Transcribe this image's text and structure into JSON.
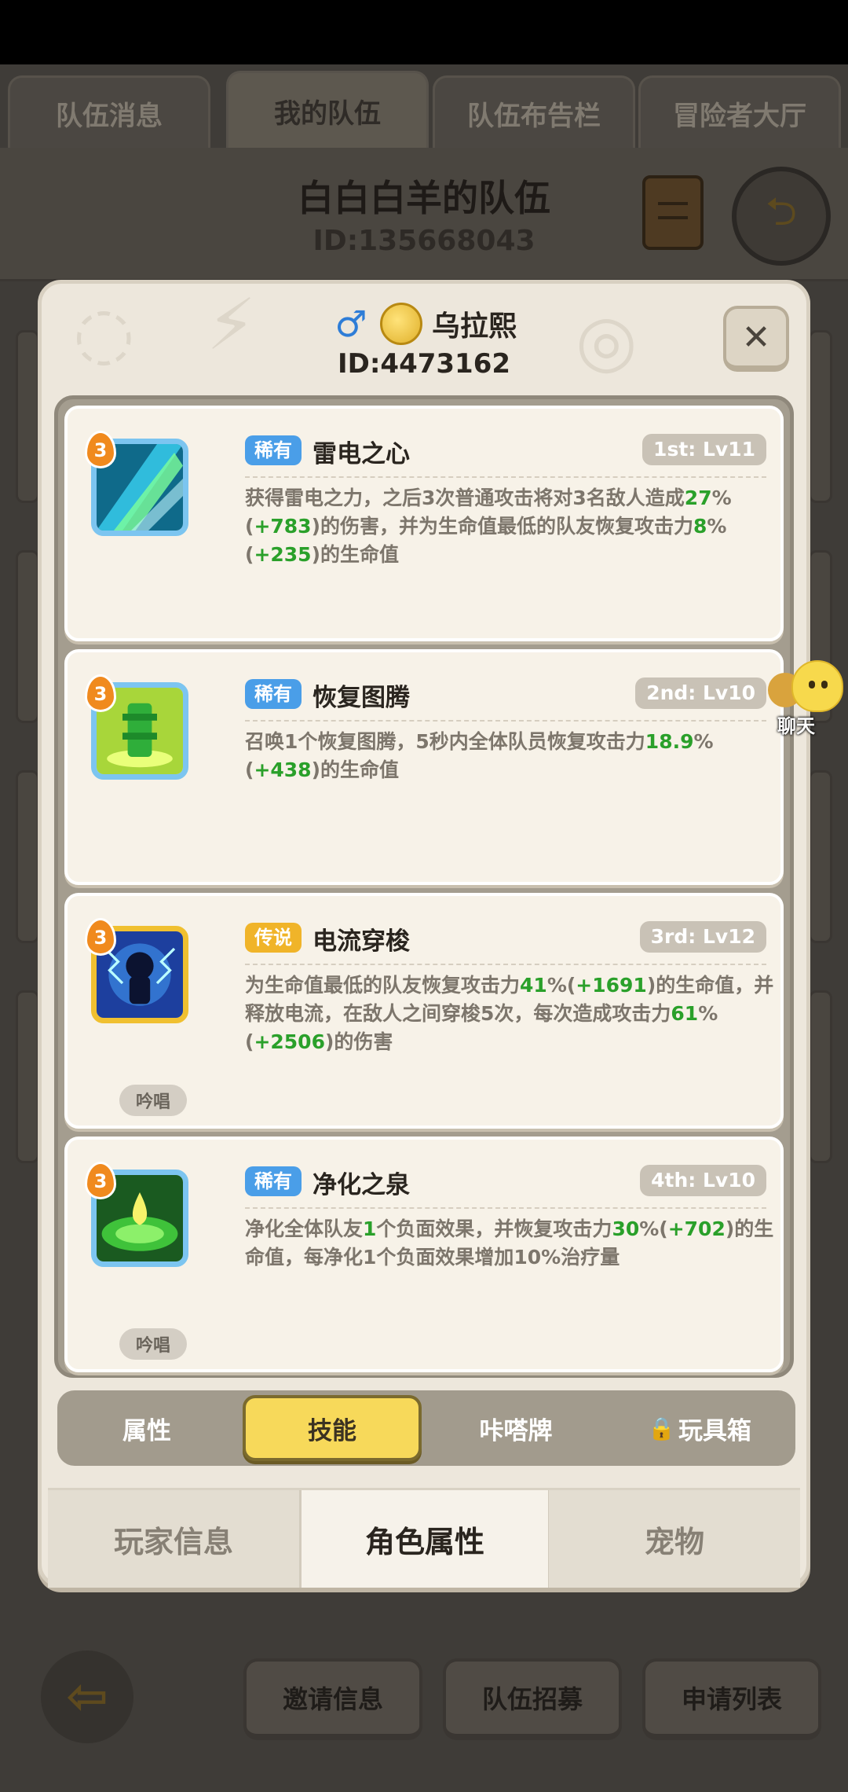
{
  "top_tabs": [
    "队伍消息",
    "我的队伍",
    "队伍布告栏",
    "冒险者大厅"
  ],
  "team": {
    "name": "白白白羊的队伍",
    "id": "ID:135668043"
  },
  "modal": {
    "player_name": "乌拉熙",
    "player_id": "ID:4473162",
    "gender_icon": "♂",
    "close_label": "✕"
  },
  "skills": [
    {
      "rarity": "稀有",
      "name": "雷电之心",
      "slot": "1st: Lv11",
      "level": "3",
      "desc": [
        [
          "获得雷电之力，之后3次普通攻击将对3名敌人造成",
          ""
        ],
        [
          "27",
          "hl"
        ],
        [
          "%(",
          ""
        ],
        [
          "+783",
          "hl"
        ],
        [
          ")的伤害，并为生命值最低的队友恢复攻击力",
          ""
        ],
        [
          "8",
          "hl"
        ],
        [
          "%(",
          ""
        ],
        [
          "+235",
          "hl"
        ],
        [
          ")的生命值",
          ""
        ]
      ]
    },
    {
      "rarity": "稀有",
      "name": "恢复图腾",
      "slot": "2nd: Lv10",
      "level": "3",
      "desc": [
        [
          "召唤1个恢复图腾，5秒内全体队员恢复攻击力",
          ""
        ],
        [
          "18.9",
          "hl"
        ],
        [
          "%(",
          ""
        ],
        [
          "+438",
          "hl"
        ],
        [
          ")的生命值",
          ""
        ]
      ]
    },
    {
      "rarity": "传说",
      "name": "电流穿梭",
      "slot": "3rd: Lv12",
      "level": "3",
      "chant": "吟唱",
      "desc": [
        [
          "为生命值最低的队友恢复攻击力",
          ""
        ],
        [
          "41",
          "hl"
        ],
        [
          "%(",
          ""
        ],
        [
          "+1691",
          "hl"
        ],
        [
          ")的生命值，并释放电流，在敌人之间穿梭5次，每次造成攻击力",
          ""
        ],
        [
          "61",
          "hl"
        ],
        [
          "%(",
          ""
        ],
        [
          "+2506",
          "hl"
        ],
        [
          ")的伤害",
          ""
        ]
      ]
    },
    {
      "rarity": "稀有",
      "name": "净化之泉",
      "slot": "4th: Lv10",
      "level": "3",
      "chant": "吟唱",
      "desc": [
        [
          "净化全体队友",
          ""
        ],
        [
          "1",
          "hl"
        ],
        [
          "个负面效果，并恢复攻击力",
          ""
        ],
        [
          "30",
          "hl"
        ],
        [
          "%(",
          ""
        ],
        [
          "+702",
          "hl"
        ],
        [
          ")的生命值，每净化1个负面效果增加10%治疗量",
          ""
        ]
      ]
    }
  ],
  "sub_tabs": {
    "attr": "属性",
    "skill": "技能",
    "card": "咔嗒牌",
    "toybox": "玩具箱"
  },
  "main_tabs": {
    "player": "玩家信息",
    "character": "角色属性",
    "pet": "宠物"
  },
  "chat": {
    "label": "聊天"
  },
  "bottom_buttons": {
    "invite": "邀请信息",
    "recruit": "队伍招募",
    "apply": "申请列表"
  }
}
